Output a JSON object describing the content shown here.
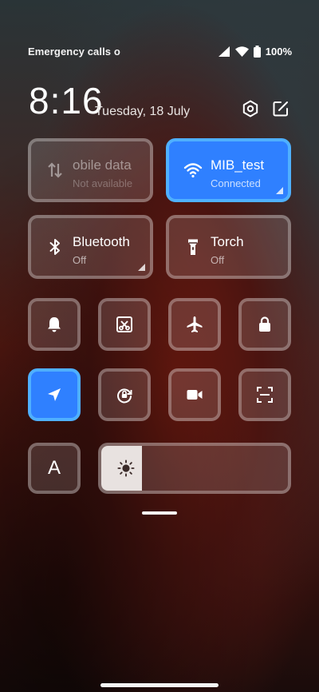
{
  "status_bar": {
    "left_text": "Emergency calls o",
    "battery_text": "100%"
  },
  "header": {
    "time": "8:16",
    "date": "Tuesday, 18 July",
    "settings_icon": "settings-hex-icon",
    "edit_icon": "edit-icon"
  },
  "tiles": {
    "mobile_data": {
      "label": "obile data",
      "sub": "Not available",
      "icon": "data-arrows-icon",
      "active": false
    },
    "wifi": {
      "label": "MIB_test",
      "sub": "Connected",
      "icon": "wifi-icon",
      "active": true
    },
    "bluetooth": {
      "label": "Bluetooth",
      "sub": "Off",
      "icon": "bluetooth-icon",
      "active": false
    },
    "torch": {
      "label": "Torch",
      "sub": "Off",
      "icon": "flashlight-icon",
      "active": false
    }
  },
  "small_tiles_row1": [
    "bell-icon",
    "screenshot-scissors-icon",
    "airplane-icon",
    "lock-icon"
  ],
  "small_tiles_row2": [
    "location-arrow-icon",
    "rotation-lock-icon",
    "video-camera-icon",
    "scan-icon"
  ],
  "auto_brightness": {
    "label": "A"
  },
  "brightness": {
    "level": 0.22,
    "icon": "sun-icon"
  },
  "colors": {
    "active_tile": "#2f80ff",
    "active_border": "#4fb0ff"
  }
}
